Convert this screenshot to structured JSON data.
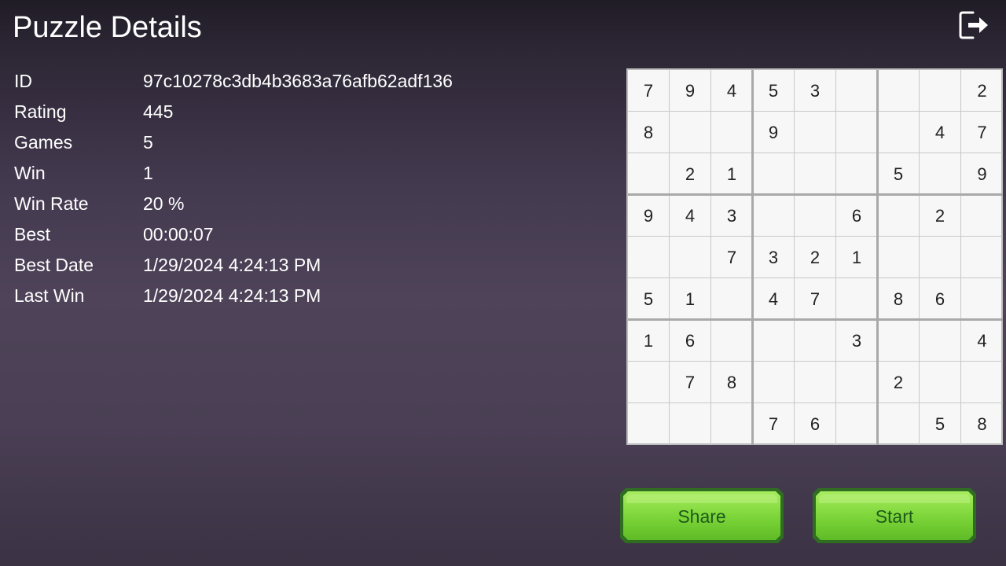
{
  "header": {
    "title": "Puzzle Details",
    "exit_icon": "exit-icon"
  },
  "details": [
    {
      "label": "ID",
      "value": "97c10278c3db4b3683a76afb62adf136"
    },
    {
      "label": "Rating",
      "value": "445"
    },
    {
      "label": "Games",
      "value": "5"
    },
    {
      "label": "Win",
      "value": "1"
    },
    {
      "label": "Win Rate",
      "value": "20 %"
    },
    {
      "label": "Best",
      "value": "00:00:07"
    },
    {
      "label": "Best Date",
      "value": "1/29/2024 4:24:13 PM"
    },
    {
      "label": "Last Win",
      "value": "1/29/2024 4:24:13 PM"
    }
  ],
  "board": [
    [
      "7",
      "9",
      "4",
      "5",
      "3",
      "",
      "",
      "",
      "2"
    ],
    [
      "8",
      "",
      "",
      "9",
      "",
      "",
      "",
      "4",
      "7"
    ],
    [
      "",
      "2",
      "1",
      "",
      "",
      "",
      "5",
      "",
      "9"
    ],
    [
      "9",
      "4",
      "3",
      "",
      "",
      "6",
      "",
      "2",
      ""
    ],
    [
      "",
      "",
      "7",
      "3",
      "2",
      "1",
      "",
      "",
      ""
    ],
    [
      "5",
      "1",
      "",
      "4",
      "7",
      "",
      "8",
      "6",
      ""
    ],
    [
      "1",
      "6",
      "",
      "",
      "",
      "3",
      "",
      "",
      "4"
    ],
    [
      "",
      "7",
      "8",
      "",
      "",
      "",
      "2",
      "",
      ""
    ],
    [
      "",
      "",
      "",
      "7",
      "6",
      "",
      "",
      "5",
      "8"
    ]
  ],
  "actions": {
    "share_label": "Share",
    "start_label": "Start"
  },
  "colors": {
    "button_green": "#7ed63a",
    "button_border": "#2f6e21",
    "button_text": "#1f5a1a"
  }
}
